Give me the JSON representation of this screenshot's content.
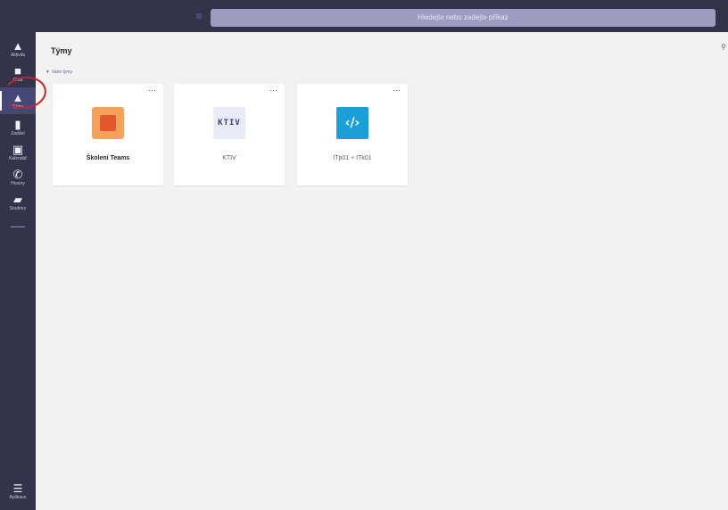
{
  "search": {
    "placeholder": "Hledejte nebo zadejte příkaz"
  },
  "rail": {
    "items": [
      {
        "id": "activity",
        "label": "Aktivita",
        "icon": "bell-icon"
      },
      {
        "id": "chat",
        "label": "Chat",
        "icon": "chat-icon"
      },
      {
        "id": "teams",
        "label": "Týmy",
        "icon": "teams-icon"
      },
      {
        "id": "assignments",
        "label": "Zadání",
        "icon": "assignments-icon"
      },
      {
        "id": "calendar",
        "label": "Kalendář",
        "icon": "calendar-icon"
      },
      {
        "id": "calls",
        "label": "Hovory",
        "icon": "phone-icon"
      },
      {
        "id": "files",
        "label": "Soubory",
        "icon": "file-icon"
      }
    ],
    "more": "...",
    "bottom": {
      "label": "Aplikace",
      "icon": "apps-icon"
    }
  },
  "header": {
    "title": "Týmy",
    "right": "⚲"
  },
  "section": {
    "label": "Vaše týmy"
  },
  "cards": [
    {
      "name": "Školení Teams",
      "avatar": "orange",
      "more": "···"
    },
    {
      "name": "KTIV",
      "avatar_text": "KTIV",
      "more": "···"
    },
    {
      "name": "ITp01 + ITk01",
      "avatar_text": "‹/›",
      "more": "···"
    }
  ],
  "colors": {
    "rail": "#33344a",
    "active": "#464775",
    "accent": "#6264a7",
    "annotation": "#c4262e"
  }
}
